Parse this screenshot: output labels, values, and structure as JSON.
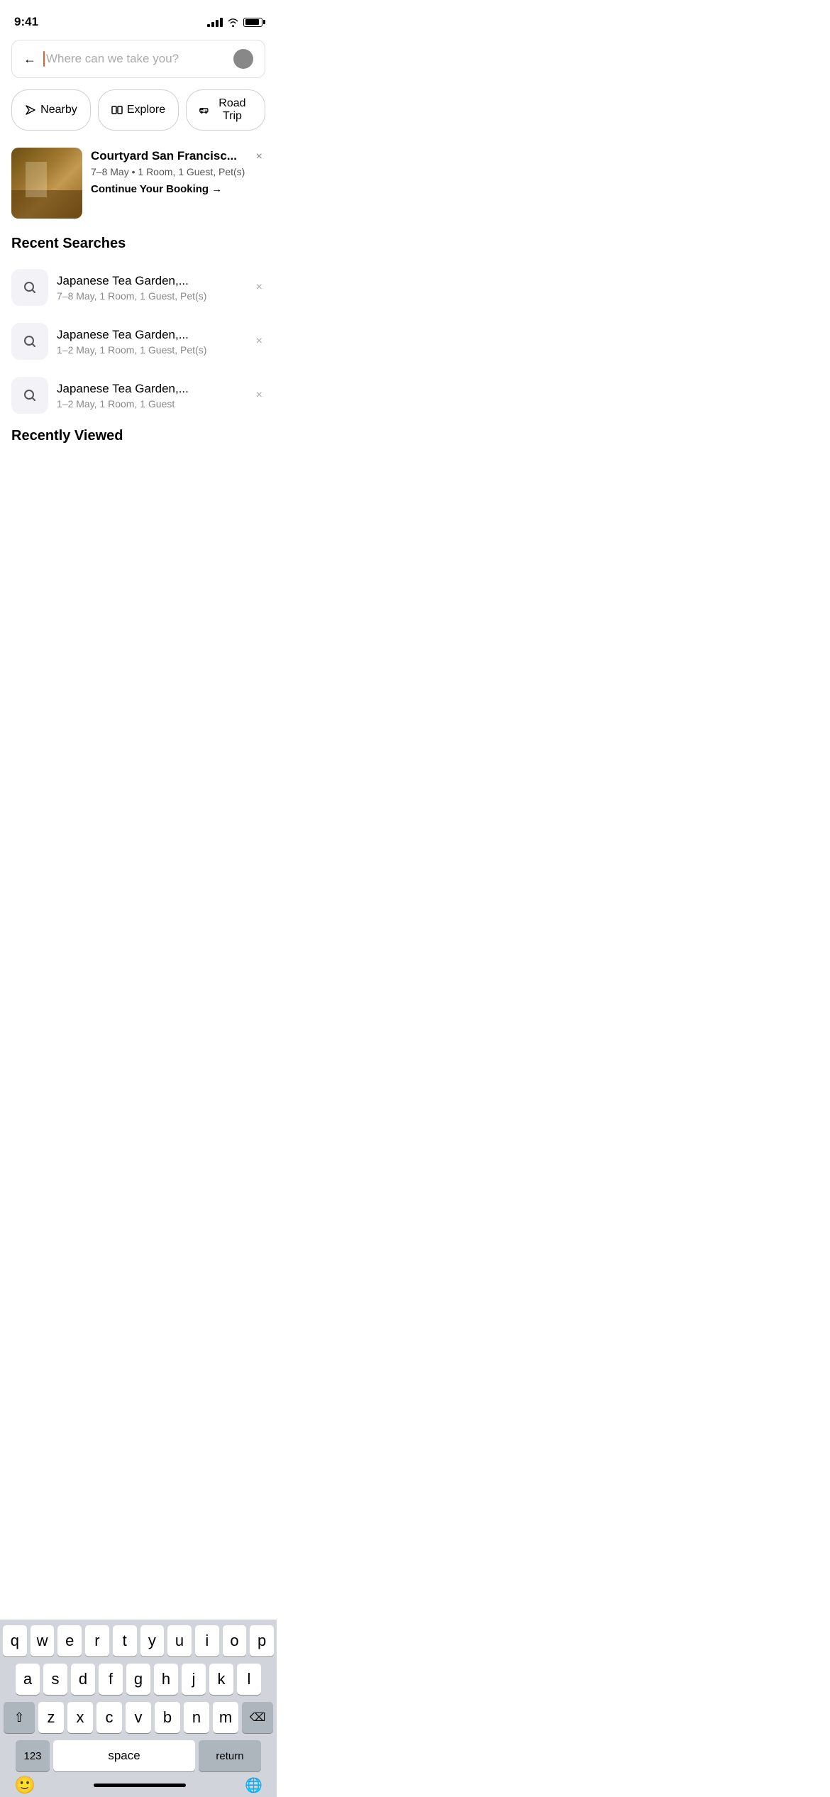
{
  "statusBar": {
    "time": "9:41",
    "signal": [
      3,
      6,
      9,
      12,
      15
    ],
    "wifi": true,
    "battery": 90
  },
  "searchBar": {
    "placeholder": "Where can we take you?",
    "backArrow": "←"
  },
  "quickActions": [
    {
      "id": "nearby",
      "label": "Nearby",
      "icon": "⊳"
    },
    {
      "id": "explore",
      "label": "Explore",
      "icon": "⊞"
    },
    {
      "id": "road-trip",
      "label": "Road Trip",
      "icon": "⊡"
    }
  ],
  "bookingCard": {
    "name": "Courtyard San Francisc...",
    "dates": "7–8 May",
    "details": "1 Room, 1 Guest, Pet(s)",
    "cta": "Continue Your Booking →",
    "closeLabel": "×"
  },
  "recentSearches": {
    "title": "Recent Searches",
    "items": [
      {
        "name": "Japanese Tea Garden,...",
        "details": "7–8 May, 1 Room, 1 Guest, Pet(s)"
      },
      {
        "name": "Japanese Tea Garden,...",
        "details": "1–2 May, 1 Room, 1 Guest, Pet(s)"
      },
      {
        "name": "Japanese Tea Garden,...",
        "details": "1–2 May, 1 Room, 1 Guest"
      }
    ],
    "closeLabel": "×"
  },
  "recentlyViewed": {
    "title": "Recently Viewed"
  },
  "keyboard": {
    "rows": [
      [
        "q",
        "w",
        "e",
        "r",
        "t",
        "y",
        "u",
        "i",
        "o",
        "p"
      ],
      [
        "a",
        "s",
        "d",
        "f",
        "g",
        "h",
        "j",
        "k",
        "l"
      ],
      [
        "z",
        "x",
        "c",
        "v",
        "b",
        "n",
        "m"
      ]
    ],
    "shift": "⇧",
    "delete": "⌫",
    "numbers": "123",
    "space": "space",
    "return": "return"
  }
}
